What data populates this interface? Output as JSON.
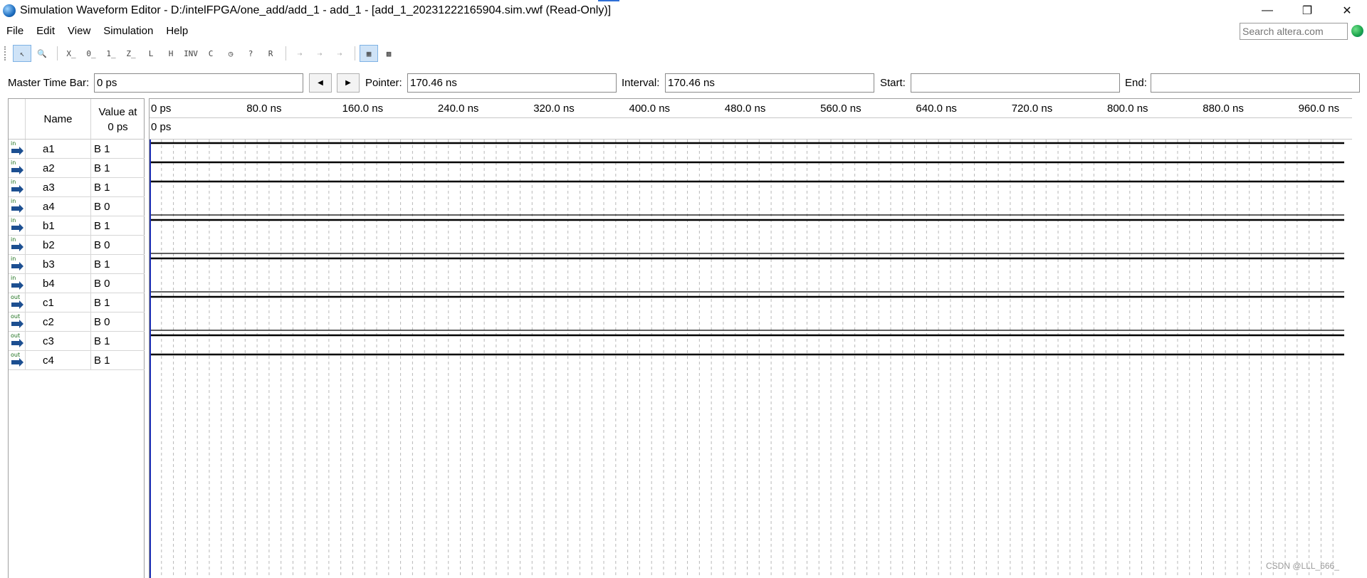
{
  "window": {
    "title": "Simulation Waveform Editor - D:/intelFPGA/one_add/add_1 - add_1 - [add_1_20231222165904.sim.vwf (Read-Only)]",
    "controls": {
      "minimize": "—",
      "restore": "❐",
      "close": "✕"
    }
  },
  "menu": {
    "items": [
      "File",
      "Edit",
      "View",
      "Simulation",
      "Help"
    ],
    "search_placeholder": "Search altera.com"
  },
  "toolbar": {
    "buttons": [
      {
        "icon": "selection-tool-icon",
        "glyph": "↖",
        "active": true
      },
      {
        "icon": "zoom-tool-icon",
        "glyph": "🔍",
        "active": false
      },
      {
        "icon": "forcing-unknown-icon",
        "glyph": "X̲"
      },
      {
        "icon": "forcing-low-icon",
        "glyph": "0̲"
      },
      {
        "icon": "forcing-high-icon",
        "glyph": "1̲"
      },
      {
        "icon": "high-impedance-icon",
        "glyph": "Z̲"
      },
      {
        "icon": "weak-low-icon",
        "glyph": "L"
      },
      {
        "icon": "weak-high-icon",
        "glyph": "H"
      },
      {
        "icon": "invert-icon",
        "glyph": "INV"
      },
      {
        "icon": "count-value-icon",
        "glyph": "C"
      },
      {
        "icon": "overwrite-clock-icon",
        "glyph": "◷"
      },
      {
        "icon": "dont-care-icon",
        "glyph": "?"
      },
      {
        "icon": "random-values-icon",
        "glyph": "R"
      },
      {
        "icon": "run-functional-simulation-icon",
        "glyph": "⇢",
        "disabled": true
      },
      {
        "icon": "run-timing-simulation-icon",
        "glyph": "⇢",
        "disabled": true
      },
      {
        "icon": "generate-netlist-icon",
        "glyph": "⇢",
        "disabled": true
      },
      {
        "icon": "snap-to-grid-icon",
        "glyph": "▦",
        "active": true
      },
      {
        "icon": "grid-settings-icon",
        "glyph": "▩"
      }
    ]
  },
  "timebar": {
    "master_label": "Master Time Bar:",
    "master_value": "0 ps",
    "pointer_label": "Pointer:",
    "pointer_value": "170.46 ns",
    "interval_label": "Interval:",
    "interval_value": "170.46 ns",
    "start_label": "Start:",
    "start_value": "",
    "end_label": "End:",
    "end_value": "",
    "prev_glyph": "◀",
    "next_glyph": "▶"
  },
  "columns": {
    "name": "Name",
    "value_line1": "Value at",
    "value_line2": "0 ps"
  },
  "signals": [
    {
      "direction": "in",
      "name": "a1",
      "value": "B 1",
      "level": 1
    },
    {
      "direction": "in",
      "name": "a2",
      "value": "B 1",
      "level": 1
    },
    {
      "direction": "in",
      "name": "a3",
      "value": "B 1",
      "level": 1
    },
    {
      "direction": "in",
      "name": "a4",
      "value": "B 0",
      "level": 0
    },
    {
      "direction": "in",
      "name": "b1",
      "value": "B 1",
      "level": 1
    },
    {
      "direction": "in",
      "name": "b2",
      "value": "B 0",
      "level": 0
    },
    {
      "direction": "in",
      "name": "b3",
      "value": "B 1",
      "level": 1
    },
    {
      "direction": "in",
      "name": "b4",
      "value": "B 0",
      "level": 0
    },
    {
      "direction": "out",
      "name": "c1",
      "value": "B 1",
      "level": 1
    },
    {
      "direction": "out",
      "name": "c2",
      "value": "B 0",
      "level": 0
    },
    {
      "direction": "out",
      "name": "c3",
      "value": "B 1",
      "level": 1
    },
    {
      "direction": "out",
      "name": "c4",
      "value": "B 1",
      "level": 1
    }
  ],
  "ruler": {
    "ticks": [
      "0 ps",
      "80.0 ns",
      "160.0 ns",
      "240.0 ns",
      "320.0 ns",
      "400.0 ns",
      "480.0 ns",
      "560.0 ns",
      "640.0 ns",
      "720.0 ns",
      "800.0 ns",
      "880.0 ns",
      "960.0 ns"
    ],
    "cursor_label": "0 ps"
  },
  "watermark": "CSDN @LLL_666_"
}
